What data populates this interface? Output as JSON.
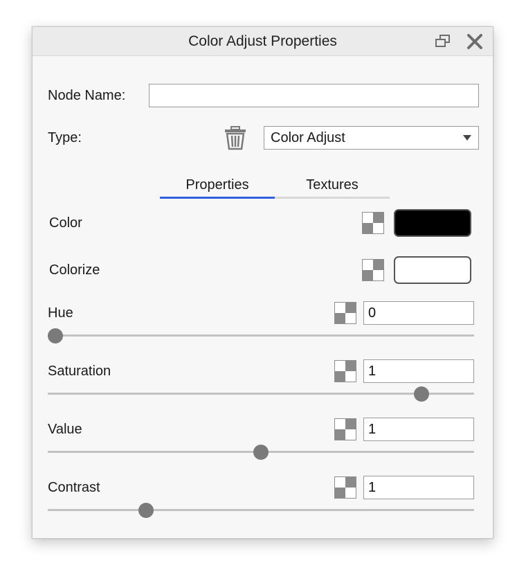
{
  "window": {
    "title": "Color Adjust Properties"
  },
  "node": {
    "label": "Node Name:",
    "value": "",
    "placeholder": ""
  },
  "type": {
    "label": "Type:",
    "selected": "Color Adjust"
  },
  "tabs": [
    {
      "label": "Properties",
      "active": true
    },
    {
      "label": "Textures",
      "active": false
    }
  ],
  "accent_color": "#3060e0",
  "color": {
    "label": "Color",
    "swatch": "#000000"
  },
  "colorize": {
    "label": "Colorize",
    "swatch": "#ffffff"
  },
  "sliders": [
    {
      "label": "Hue",
      "value": "0",
      "position": 0.0
    },
    {
      "label": "Saturation",
      "value": "1",
      "position": 0.89
    },
    {
      "label": "Value",
      "value": "1",
      "position": 0.5
    },
    {
      "label": "Contrast",
      "value": "1",
      "position": 0.22
    }
  ]
}
